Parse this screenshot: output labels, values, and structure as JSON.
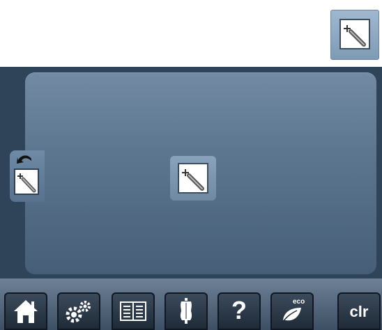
{
  "colors": {
    "screen_bg": "#2f4458",
    "panel_top": "#728aa4",
    "panel_bottom": "#465e77",
    "toolbar_button": "#1e2a37",
    "accent_button": "#9fb8d0"
  },
  "top": {
    "needle_button": {
      "icon": "needle-threader-icon"
    }
  },
  "panel": {
    "back_button": {
      "icon": "back-arrow-icon"
    },
    "side_needle": {
      "icon": "needle-threader-icon"
    },
    "center_needle": {
      "icon": "needle-threader-icon"
    }
  },
  "toolbar": {
    "home_icon": "home-icon",
    "setup_icon": "gear-icon",
    "tutorial_icon": "book-icon",
    "consultant_icon": "dress-form-icon",
    "help_label": "?",
    "eco_label": "eco",
    "clr_label": "clr"
  }
}
